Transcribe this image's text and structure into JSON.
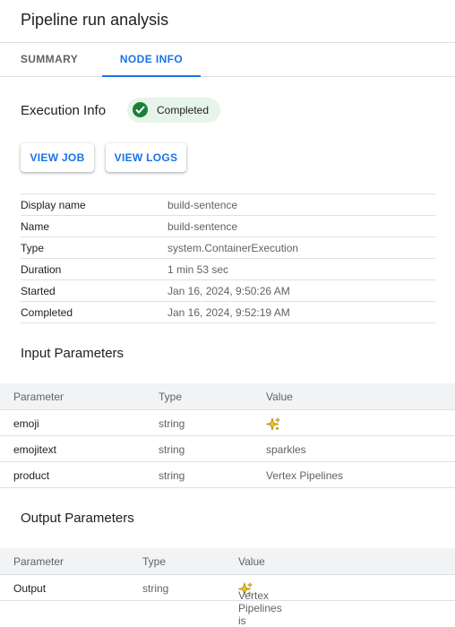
{
  "header": {
    "title": "Pipeline run analysis"
  },
  "tabs": [
    {
      "label": "SUMMARY",
      "active": false
    },
    {
      "label": "NODE INFO",
      "active": true
    }
  ],
  "execution": {
    "title": "Execution Info",
    "status": "Completed",
    "status_color": "#188038",
    "buttons": {
      "view_job": "VIEW JOB",
      "view_logs": "VIEW LOGS"
    },
    "rows": [
      {
        "key": "Display name",
        "value": "build-sentence"
      },
      {
        "key": "Name",
        "value": "build-sentence"
      },
      {
        "key": "Type",
        "value": "system.ContainerExecution"
      },
      {
        "key": "Duration",
        "value": "1 min 53 sec"
      },
      {
        "key": "Started",
        "value": "Jan 16, 2024, 9:50:26 AM"
      },
      {
        "key": "Completed",
        "value": "Jan 16, 2024, 9:52:19 AM"
      }
    ]
  },
  "input_parameters": {
    "title": "Input Parameters",
    "headers": {
      "parameter": "Parameter",
      "type": "Type",
      "value": "Value"
    },
    "rows": [
      {
        "parameter": "emoji",
        "type": "string",
        "value": "",
        "icon": "sparkles-icon"
      },
      {
        "parameter": "emojitext",
        "type": "string",
        "value": "sparkles"
      },
      {
        "parameter": "product",
        "type": "string",
        "value": "Vertex Pipelines"
      }
    ]
  },
  "output_parameters": {
    "title": "Output Parameters",
    "headers": {
      "parameter": "Parameter",
      "type": "Type",
      "value": "Value"
    },
    "rows": [
      {
        "parameter": "Output",
        "type": "string",
        "value": "Vertex Pipelines is",
        "icon": "sparkles-icon"
      }
    ]
  },
  "colors": {
    "accent": "#1a73e8",
    "success_bg": "#e6f4ea",
    "success": "#188038"
  }
}
